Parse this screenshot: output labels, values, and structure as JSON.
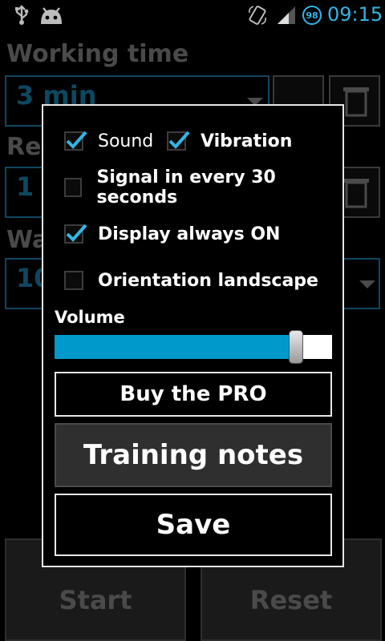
{
  "status_bar": {
    "time": "09:15",
    "battery_level": "98",
    "accent_color": "#33b5e5"
  },
  "background": {
    "working_time_label": "Working time",
    "working_time_value": "3 min",
    "rest_label_partial": "Res",
    "rest_value_partial": "1",
    "wait_label_partial": "Wa",
    "wait_value_partial": "10",
    "start_label": "Start",
    "reset_label": "Reset"
  },
  "dialog": {
    "options": {
      "sound": {
        "label": "Sound",
        "checked": true
      },
      "vibration": {
        "label": "Vibration",
        "checked": true
      },
      "signal": {
        "label": "Signal in every 30 seconds",
        "checked": false
      },
      "display_on": {
        "label": "Display always ON",
        "checked": true
      },
      "landscape": {
        "label": "Orientation landscape",
        "checked": false
      }
    },
    "volume": {
      "label": "Volume",
      "level_fraction": 0.87,
      "fill_color": "#0099cc"
    },
    "buy_label": "Buy the PRO",
    "notes_label": "Training notes",
    "save_label": "Save"
  }
}
